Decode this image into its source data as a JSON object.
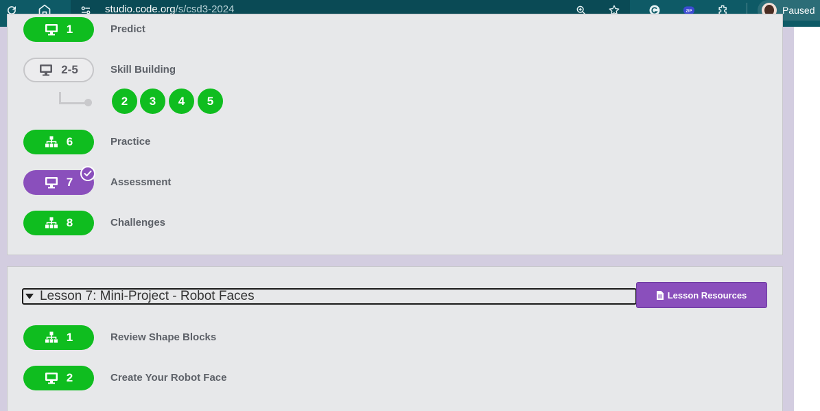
{
  "browser": {
    "url_host": "studio.code.org",
    "url_path": "/s/csd3-2024",
    "profile_label": "Paused",
    "icons": [
      "reload-icon",
      "home-icon",
      "site-info-icon",
      "zoom-icon",
      "star-icon",
      "grammarly-icon",
      "zip-extension-icon",
      "extensions-icon",
      "avatar"
    ]
  },
  "lesson6": {
    "levels": [
      {
        "number": "1",
        "label": "Predict",
        "icon": "monitor-icon",
        "state": "complete"
      },
      {
        "number": "2-5",
        "label": "Skill Building",
        "icon": "monitor-icon",
        "state": "not-started"
      },
      {
        "number": "6",
        "label": "Practice",
        "icon": "network-icon",
        "state": "complete"
      },
      {
        "number": "7",
        "label": "Assessment",
        "icon": "monitor-icon",
        "state": "assessment"
      },
      {
        "number": "8",
        "label": "Challenges",
        "icon": "network-icon",
        "state": "complete"
      }
    ],
    "sublevels": [
      "2",
      "3",
      "4",
      "5"
    ]
  },
  "lesson7": {
    "title": "Lesson 7: Mini-Project - Robot Faces",
    "resources_label": "Lesson Resources",
    "levels": [
      {
        "number": "1",
        "label": "Review Shape Blocks",
        "icon": "network-icon",
        "state": "complete"
      },
      {
        "number": "2",
        "label": "Create Your Robot Face",
        "icon": "monitor-icon",
        "state": "complete"
      }
    ]
  },
  "colors": {
    "toolbar": "#0e5a66",
    "complete": "#0fbd1f",
    "assessment": "#8a4fbc",
    "card": "#e7e8ea",
    "page_bg": "#d3cde0"
  }
}
